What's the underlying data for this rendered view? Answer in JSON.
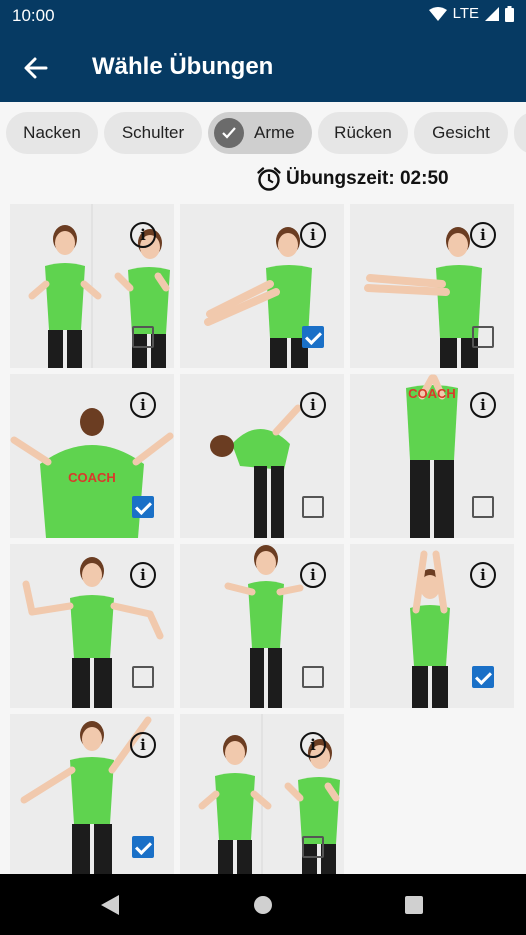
{
  "status": {
    "time": "10:00",
    "network": "LTE"
  },
  "header": {
    "title": "Wähle Übungen"
  },
  "categories": [
    {
      "label": "Nacken",
      "selected": false
    },
    {
      "label": "Schulter",
      "selected": false
    },
    {
      "label": "Arme",
      "selected": true
    },
    {
      "label": "Rücken",
      "selected": false
    },
    {
      "label": "Gesicht",
      "selected": false
    }
  ],
  "timer": {
    "text": "Übungszeit: 02:50"
  },
  "exercises": [
    {
      "pose": "fists-split",
      "checked": false
    },
    {
      "pose": "arms-forward-crossed",
      "checked": true
    },
    {
      "pose": "arms-forward-stretch",
      "checked": false
    },
    {
      "pose": "back-arms-spread",
      "checked": true,
      "shirt_text": "COACH"
    },
    {
      "pose": "bend-forward",
      "checked": false
    },
    {
      "pose": "back-hands-neck",
      "checked": false,
      "shirt_text": "COACH"
    },
    {
      "pose": "arms-wave",
      "checked": false
    },
    {
      "pose": "side-arms-behind",
      "checked": false
    },
    {
      "pose": "arms-overhead",
      "checked": true
    },
    {
      "pose": "arm-diagonal",
      "checked": true
    },
    {
      "pose": "fists-split-2",
      "checked": false
    }
  ],
  "colors": {
    "primary": "#063a63",
    "checkbox": "#1a70c7",
    "shirt": "#5fd34f",
    "pants": "#1c1c1c"
  },
  "icons": {
    "back": "arrow-left-icon",
    "alarm": "alarm-clock-icon",
    "info": "info-icon",
    "check": "check-icon"
  }
}
